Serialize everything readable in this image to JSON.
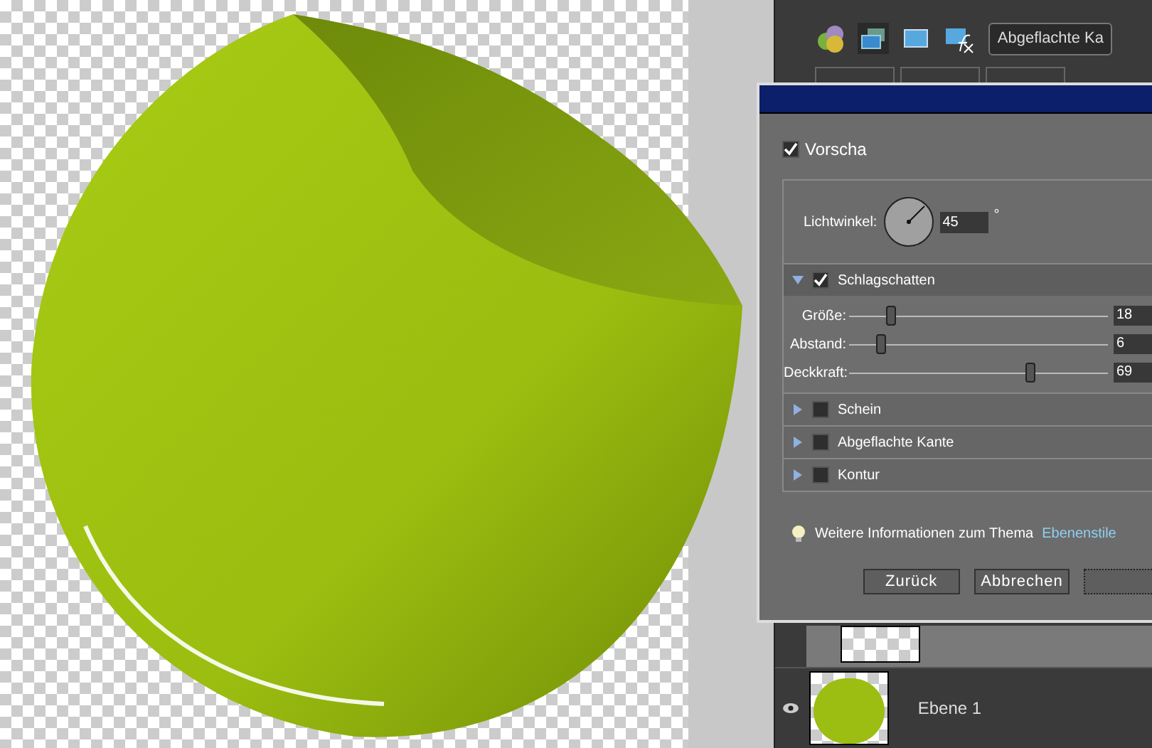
{
  "effects_panel": {
    "style_dropdown": {
      "value": "Abgeflachte Ka"
    }
  },
  "dialog": {
    "preview": {
      "label": "Vorscha",
      "checked": true
    },
    "light_angle": {
      "label": "Lichtwinkel:",
      "value": "45",
      "unit": "°"
    },
    "sections": [
      {
        "title": "Schlagschatten",
        "checked": true,
        "expanded": true,
        "sliders": [
          {
            "label": "Größe:",
            "level": 0.16,
            "value": "18"
          },
          {
            "label": "Abstand:",
            "level": 0.12,
            "value": "6"
          },
          {
            "label": "Deckkraft:",
            "level": 0.7,
            "value": "69"
          }
        ]
      },
      {
        "title": "Schein",
        "checked": false,
        "expanded": false
      },
      {
        "title": "Abgeflachte Kante",
        "checked": false,
        "expanded": false
      },
      {
        "title": "Kontur",
        "checked": false,
        "expanded": false
      }
    ],
    "info": {
      "text": "Weitere Informationen zum Thema",
      "link": "Ebenenstile"
    },
    "buttons": [
      "Zurück",
      "Abbrechen"
    ]
  },
  "layers": [
    {
      "name": "Ebene 1",
      "visible": true
    }
  ]
}
